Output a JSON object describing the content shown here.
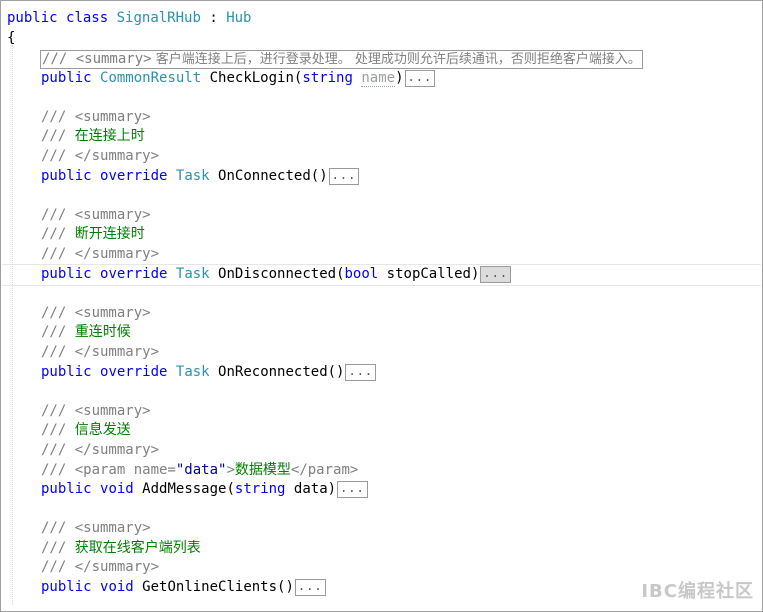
{
  "code": {
    "class_decl": {
      "kw1": "public",
      "kw2": "class",
      "name": "SignalRHub",
      "colon": " : ",
      "base": "Hub"
    },
    "open_brace": "{",
    "summary_collapsed": {
      "prefix": "/// <summary>",
      "text": " 客户端连接上后，进行登录处理。 处理成功则允许后续通讯，否则拒绝客户端接入。"
    },
    "method1": {
      "kw": "public",
      "ret": "CommonResult",
      "name": "CheckLogin",
      "paren_open": "(",
      "ptype": "string",
      "pname": "name",
      "paren_close": ")"
    },
    "doc_open": "/// <summary>",
    "doc_close": "/// </summary>",
    "doc_prefix": "/// ",
    "c2": "在连接上时",
    "method2": {
      "kw": "public",
      "kw2": "override",
      "ret": "Task",
      "name": "OnConnected",
      "params": "()"
    },
    "c3": "断开连接时",
    "method3": {
      "kw": "public",
      "kw2": "override",
      "ret": "Task",
      "name": "OnDisconnected",
      "paren_open": "(",
      "ptype": "bool",
      "pname": "stopCalled",
      "paren_close": ")"
    },
    "c4": "重连时候",
    "method4": {
      "kw": "public",
      "kw2": "override",
      "ret": "Task",
      "name": "OnReconnected",
      "params": "()"
    },
    "c5": "信息发送",
    "param_doc": {
      "open": "<param name=",
      "value": "\"data\"",
      "gt": ">",
      "text": "数据模型",
      "close": "</param>"
    },
    "method5": {
      "kw": "public",
      "kw2": "void",
      "name": "AddMessage",
      "paren_open": "(",
      "ptype": "string",
      "pname": "data",
      "paren_close": ")"
    },
    "c6": "获取在线客户端列表",
    "method6": {
      "kw": "public",
      "kw2": "void",
      "name": "GetOnlineClients",
      "params": "()"
    },
    "ellipsis": "..."
  },
  "watermark": "IBC编程社区",
  "colors": {
    "keyword": "#0000ff",
    "type": "#2b91af",
    "comment": "#808080",
    "comment_text": "#008000"
  }
}
